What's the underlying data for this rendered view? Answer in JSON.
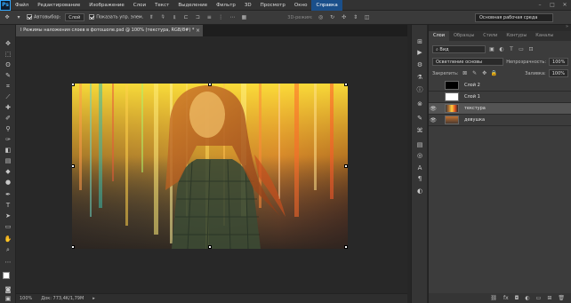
{
  "app": {
    "logo_text": "Ps"
  },
  "menubar": {
    "items": [
      "Файл",
      "Редактирование",
      "Изображение",
      "Слои",
      "Текст",
      "Выделение",
      "Фильтр",
      "3D",
      "Просмотр",
      "Окно",
      "Справка"
    ],
    "active_index": 10
  },
  "optionsbar": {
    "autoselect_label": "Автовыбор:",
    "autoselect_value": "Слой",
    "show_controls_label": "Показать упр. элем.",
    "mode_3d_label": "3D-режим:",
    "workspace_value": "Основная рабочая среда"
  },
  "document": {
    "tab_title": "I Режимы наложения слоев в фотошопе.psd @ 100% (текстура, RGB/8#) *",
    "tab_close": "×"
  },
  "statusbar": {
    "zoom": "100%",
    "doc_info": "Док: 773,4K/1,79M"
  },
  "layers_panel": {
    "tabs": [
      "Слои",
      "Образцы",
      "Стили",
      "Контуры",
      "Каналы"
    ],
    "active_tab": 0,
    "filter_kind": "Вид",
    "blend_mode": "Осветление основы",
    "opacity_label": "Непрозрачность:",
    "opacity_value": "100%",
    "lock_label": "Закрепить:",
    "fill_label": "Заливка:",
    "fill_value": "100%",
    "layers": [
      {
        "name": "Слой 2",
        "visible": false,
        "selected": false,
        "thumb": "#000000"
      },
      {
        "name": "Слой 1",
        "visible": false,
        "selected": false,
        "thumb": "#ffffff"
      },
      {
        "name": "текстура",
        "visible": true,
        "selected": true,
        "thumb": "texture"
      },
      {
        "name": "девушка",
        "visible": true,
        "selected": false,
        "thumb": "photo"
      }
    ],
    "bottom_icons": [
      "link-icon",
      "fx-icon",
      "mask-icon",
      "adjustment-icon",
      "folder-icon",
      "new-layer-icon",
      "trash-icon"
    ]
  },
  "colors": {
    "accent": "#31a8ff",
    "menu_active": "#1a4f8a",
    "selected_layer": "#545454"
  }
}
